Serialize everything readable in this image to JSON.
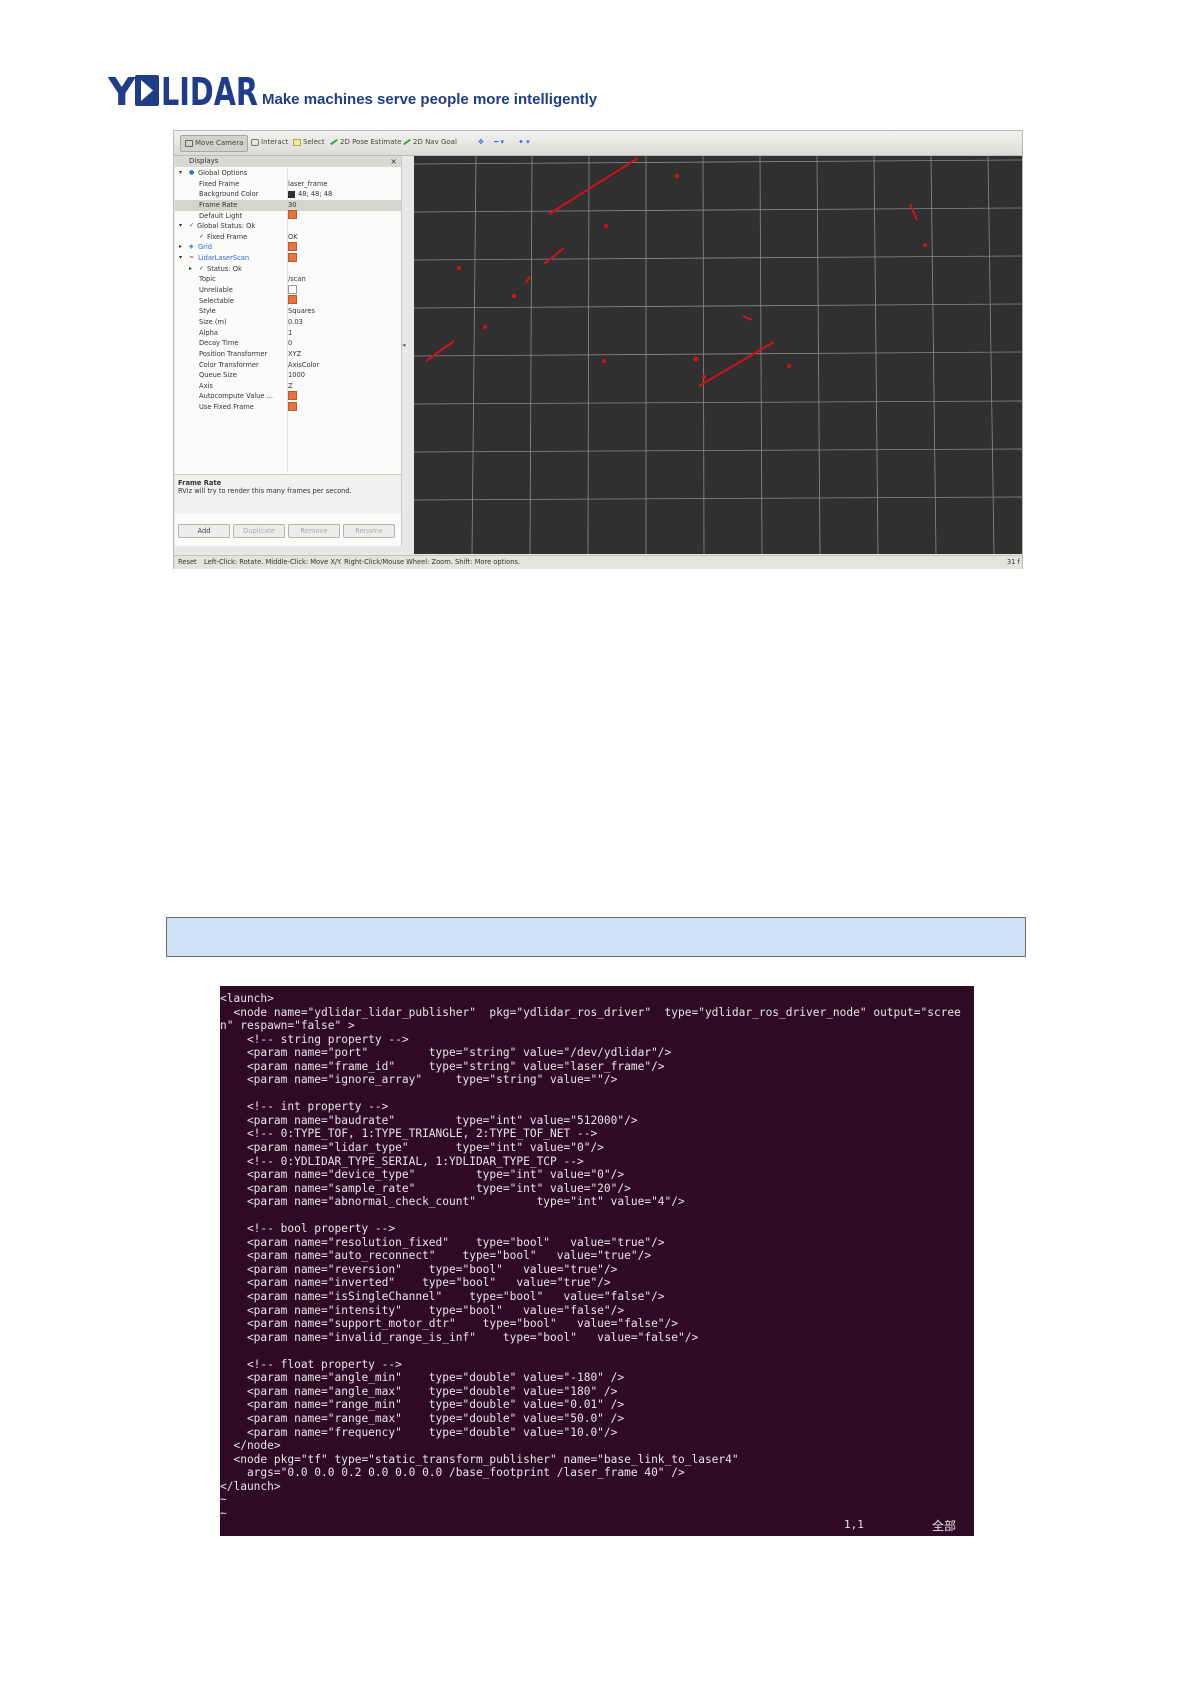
{
  "header": {
    "logo_text": "YDLIDAR",
    "slogan": "Make machines serve people more intelligently",
    "brand_color": "#1f3c88"
  },
  "rviz": {
    "toolbar": [
      "Move Camera",
      "Interact",
      "Select",
      "2D Pose Estimate",
      "2D Nav Goal"
    ],
    "panel_title": "Displays",
    "tree": [
      {
        "k": "Global Options",
        "v": "",
        "indent": 1,
        "arrow": "▾",
        "kind": "folder"
      },
      {
        "k": "Fixed Frame",
        "v": "laser_frame",
        "indent": 2
      },
      {
        "k": "Background Color",
        "v": "48; 48; 48",
        "indent": 2,
        "swatch": true
      },
      {
        "k": "Frame Rate",
        "v": "30",
        "indent": 2,
        "sel": true
      },
      {
        "k": "Default Light",
        "v": "",
        "indent": 2,
        "check": "on"
      },
      {
        "k": "Global Status: Ok",
        "v": "",
        "indent": 1,
        "arrow": "▾",
        "tick": true
      },
      {
        "k": "Fixed Frame",
        "v": "OK",
        "indent": 2,
        "tick": true
      },
      {
        "k": "Grid",
        "v": "",
        "indent": 1,
        "arrow": "▸",
        "check": "on",
        "color": "blue"
      },
      {
        "k": "LidarLaserScan",
        "v": "",
        "indent": 1,
        "arrow": "▾",
        "check": "on",
        "color": "blue"
      },
      {
        "k": "Status: Ok",
        "v": "",
        "indent": 2,
        "arrow": "▸",
        "tick": true
      },
      {
        "k": "Topic",
        "v": "/scan",
        "indent": 2
      },
      {
        "k": "Unreliable",
        "v": "",
        "indent": 2,
        "check": "off"
      },
      {
        "k": "Selectable",
        "v": "",
        "indent": 2,
        "check": "on"
      },
      {
        "k": "Style",
        "v": "Squares",
        "indent": 2
      },
      {
        "k": "Size (m)",
        "v": "0.03",
        "indent": 2
      },
      {
        "k": "Alpha",
        "v": "1",
        "indent": 2
      },
      {
        "k": "Decay Time",
        "v": "0",
        "indent": 2
      },
      {
        "k": "Position Transformer",
        "v": "XYZ",
        "indent": 2
      },
      {
        "k": "Color Transformer",
        "v": "AxisColor",
        "indent": 2
      },
      {
        "k": "Queue Size",
        "v": "1000",
        "indent": 2
      },
      {
        "k": "Axis",
        "v": "Z",
        "indent": 2
      },
      {
        "k": "Autocompute Value ...",
        "v": "",
        "indent": 2,
        "check": "on"
      },
      {
        "k": "Use Fixed Frame",
        "v": "",
        "indent": 2,
        "check": "on"
      }
    ],
    "help_title": "Frame Rate",
    "help_text": "RViz will try to render this many frames per second.",
    "buttons": [
      "Add",
      "Duplicate",
      "Remove",
      "Rename"
    ],
    "status_reset": "Reset",
    "status_msg": "Left-Click: Rotate. Middle-Click: Move X/Y. Right-Click/Mouse Wheel: Zoom. Shift: More options.",
    "status_fps": "31 f",
    "scan_color": "#d0121b",
    "viewer_bg": "#303030"
  },
  "caption_box": {
    "text": "",
    "fill": "#cfe1f5"
  },
  "terminal": {
    "text": "<launch>\n  <node name=\"ydlidar_lidar_publisher\"  pkg=\"ydlidar_ros_driver\"  type=\"ydlidar_ros_driver_node\" output=\"scree\nn\" respawn=\"false\" >\n    <!-- string property -->\n    <param name=\"port\"         type=\"string\" value=\"/dev/ydlidar\"/>\n    <param name=\"frame_id\"     type=\"string\" value=\"laser_frame\"/>\n    <param name=\"ignore_array\"     type=\"string\" value=\"\"/>\n\n    <!-- int property -->\n    <param name=\"baudrate\"         type=\"int\" value=\"512000\"/>\n    <!-- 0:TYPE_TOF, 1:TYPE_TRIANGLE, 2:TYPE_TOF_NET -->\n    <param name=\"lidar_type\"       type=\"int\" value=\"0\"/>\n    <!-- 0:YDLIDAR_TYPE_SERIAL, 1:YDLIDAR_TYPE_TCP -->\n    <param name=\"device_type\"         type=\"int\" value=\"0\"/>\n    <param name=\"sample_rate\"         type=\"int\" value=\"20\"/>\n    <param name=\"abnormal_check_count\"         type=\"int\" value=\"4\"/>\n\n    <!-- bool property -->\n    <param name=\"resolution_fixed\"    type=\"bool\"   value=\"true\"/>\n    <param name=\"auto_reconnect\"    type=\"bool\"   value=\"true\"/>\n    <param name=\"reversion\"    type=\"bool\"   value=\"true\"/>\n    <param name=\"inverted\"    type=\"bool\"   value=\"true\"/>\n    <param name=\"isSingleChannel\"    type=\"bool\"   value=\"false\"/>\n    <param name=\"intensity\"    type=\"bool\"   value=\"false\"/>\n    <param name=\"support_motor_dtr\"    type=\"bool\"   value=\"false\"/>\n    <param name=\"invalid_range_is_inf\"    type=\"bool\"   value=\"false\"/>\n\n    <!-- float property -->\n    <param name=\"angle_min\"    type=\"double\" value=\"-180\" />\n    <param name=\"angle_max\"    type=\"double\" value=\"180\" />\n    <param name=\"range_min\"    type=\"double\" value=\"0.01\" />\n    <param name=\"range_max\"    type=\"double\" value=\"50.0\" />\n    <param name=\"frequency\"    type=\"double\" value=\"10.0\"/>\n  </node>\n  <node pkg=\"tf\" type=\"static_transform_publisher\" name=\"base_link_to_laser4\"\n    args=\"0.0 0.0 0.2 0.0 0.0 0.0 /base_footprint /laser_frame 40\" />\n</launch>\n~\n~",
    "cursor_pos": "1,1",
    "scroll_label": "全部",
    "bg": "#2e0a25"
  }
}
